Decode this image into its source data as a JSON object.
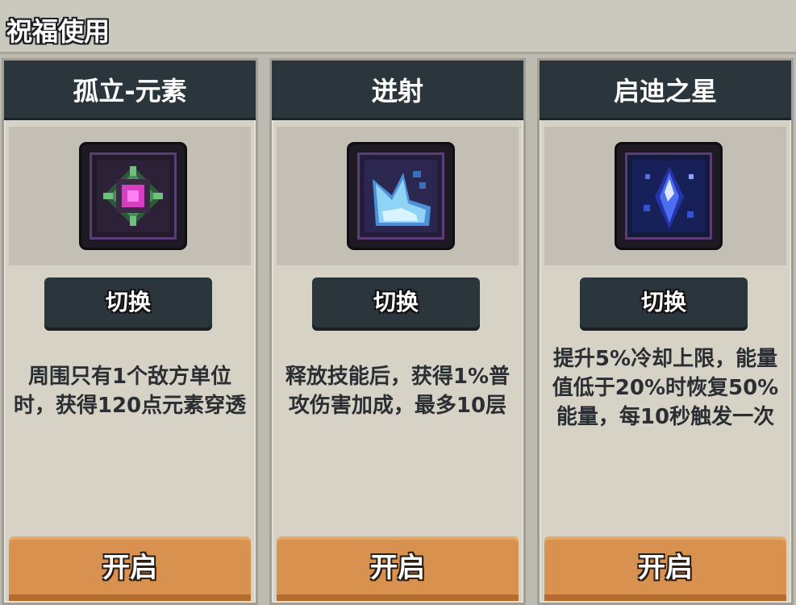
{
  "header": {
    "title": "祝福使用"
  },
  "cards": [
    {
      "title": "孤立-元素",
      "icon": "element-orb-icon",
      "switch_label": "切换",
      "description": "周围只有1个敌方单位时，获得120点元素穿透",
      "open_label": "开启"
    },
    {
      "title": "迸射",
      "icon": "burst-shard-icon",
      "switch_label": "切换",
      "description": "释放技能后，获得1%普攻伤害加成，最多10层",
      "open_label": "开启"
    },
    {
      "title": "启迪之星",
      "icon": "enlightenment-star-icon",
      "switch_label": "切换",
      "description": "提升5%冷却上限，能量值低于20%时恢复50%能量，每10秒触发一次",
      "open_label": "开启"
    }
  ],
  "colors": {
    "card_header": "#2b353c",
    "open_button": "#d9914f",
    "card_bg": "#d6d2c6"
  }
}
